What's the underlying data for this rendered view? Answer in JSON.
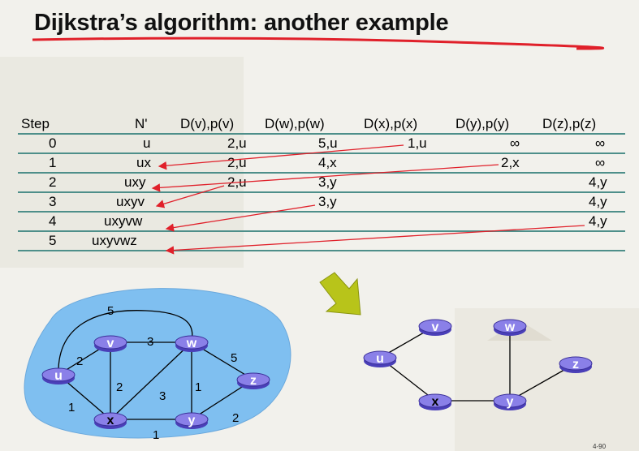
{
  "title": "Dijkstra’s algorithm: another example",
  "table": {
    "headers": [
      "Step",
      "N'",
      "D(v),p(v)",
      "D(w),p(w)",
      "D(x),p(x)",
      "D(y),p(y)",
      "D(z),p(z)"
    ],
    "rows": [
      [
        "0",
        "u",
        "2,u",
        "5,u",
        "1,u",
        "∞",
        "∞"
      ],
      [
        "1",
        "ux",
        "2,u",
        "4,x",
        "",
        "2,x",
        "∞"
      ],
      [
        "2",
        "uxy",
        "2,u",
        "3,y",
        "",
        "",
        "4,y"
      ],
      [
        "3",
        "uxyv",
        "",
        "3,y",
        "",
        "",
        "4,y"
      ],
      [
        "4",
        "uxyvw",
        "",
        "",
        "",
        "",
        "4,y"
      ],
      [
        "5",
        "uxyvwz",
        "",
        "",
        "",
        "",
        ""
      ]
    ]
  },
  "graph": {
    "nodes": [
      "u",
      "v",
      "w",
      "x",
      "y",
      "z"
    ],
    "edge_weights": {
      "u-w": "5",
      "u-v": "2",
      "v-w": "3",
      "w-z": "5",
      "u-x": "1",
      "v-x": "2",
      "x-w": "3",
      "w-y": "1",
      "x-y": "1",
      "y-z": "2"
    }
  },
  "tree": {
    "nodes": [
      "v",
      "w",
      "u",
      "z",
      "x",
      "y"
    ]
  },
  "colors": {
    "accent_red": "#e0202a",
    "table_line": "#4e8f8a",
    "cloud": "#7fbff0",
    "router": "#6a5fd8",
    "arrow_green": "#b8c41a"
  },
  "slide_number": "4-90"
}
